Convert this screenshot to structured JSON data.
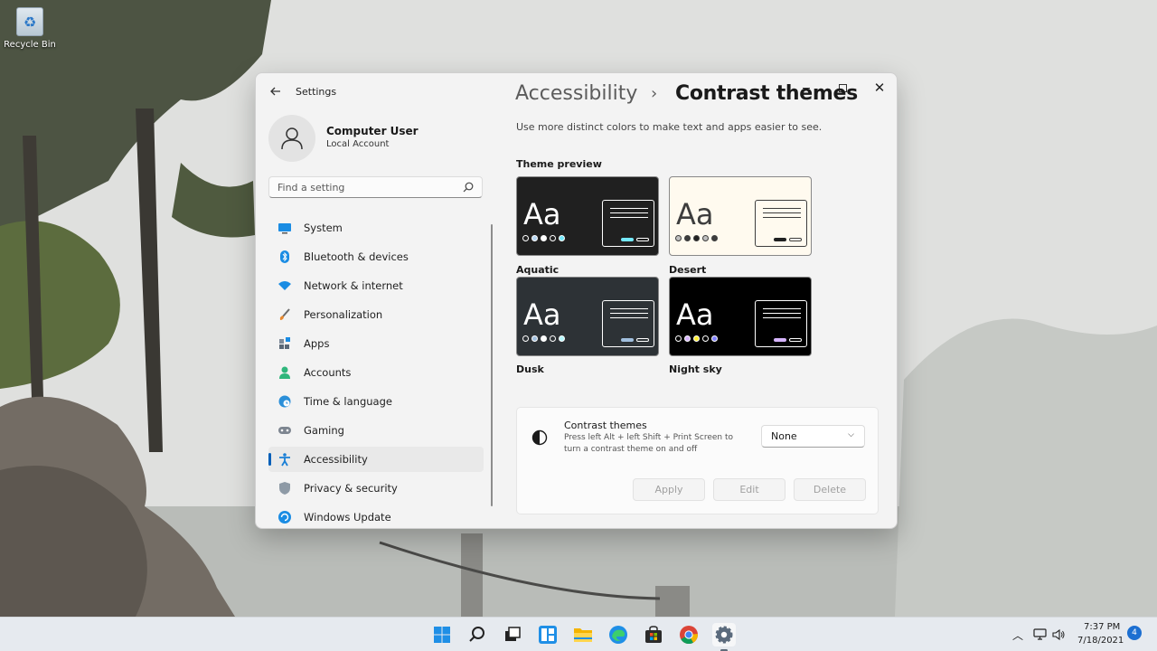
{
  "desktop": {
    "recycle_bin_label": "Recycle Bin"
  },
  "window": {
    "app_title": "Settings",
    "user": {
      "name": "Computer User",
      "account_type": "Local Account"
    },
    "search_placeholder": "Find a setting",
    "nav": [
      {
        "label": "System",
        "icon": "monitor-icon",
        "active": false
      },
      {
        "label": "Bluetooth & devices",
        "icon": "bluetooth-icon",
        "active": false
      },
      {
        "label": "Network & internet",
        "icon": "wifi-icon",
        "active": false
      },
      {
        "label": "Personalization",
        "icon": "brush-icon",
        "active": false
      },
      {
        "label": "Apps",
        "icon": "apps-icon",
        "active": false
      },
      {
        "label": "Accounts",
        "icon": "person-icon",
        "active": false
      },
      {
        "label": "Time & language",
        "icon": "globe-clock-icon",
        "active": false
      },
      {
        "label": "Gaming",
        "icon": "gamepad-icon",
        "active": false
      },
      {
        "label": "Accessibility",
        "icon": "accessibility-icon",
        "active": true
      },
      {
        "label": "Privacy & security",
        "icon": "shield-icon",
        "active": false
      },
      {
        "label": "Windows Update",
        "icon": "update-icon",
        "active": false
      }
    ],
    "breadcrumb": {
      "parent": "Accessibility",
      "separator": "›",
      "current": "Contrast themes"
    },
    "description": "Use more distinct colors to make text and apps easier to see.",
    "theme_preview_title": "Theme preview",
    "themes": [
      {
        "name": "Aquatic",
        "sample": "Aa",
        "bg": "#202020",
        "fg": "#ffffff",
        "accent": "#75e9fc",
        "dots": [
          "#202020",
          "#b6d6f2",
          "#ffffff",
          "#202020",
          "#75e9fc"
        ]
      },
      {
        "name": "Desert",
        "sample": "Aa",
        "bg": "#fffaef",
        "fg": "#3d3d3d",
        "accent": "#202020",
        "dots": [
          "#bfbfbf",
          "#3d3d3d",
          "#202020",
          "#bfbfbf",
          "#3d3d3d"
        ]
      },
      {
        "name": "Dusk",
        "sample": "Aa",
        "bg": "#2d3236",
        "fg": "#ffffff",
        "accent": "#a1bfde",
        "dots": [
          "#2d3236",
          "#a1bfde",
          "#ffffff",
          "#2d3236",
          "#b5f7fd"
        ]
      },
      {
        "name": "Night sky",
        "sample": "Aa",
        "bg": "#000000",
        "fg": "#ffffff",
        "accent": "#d6b4fd",
        "dots": [
          "#000000",
          "#d6b4fd",
          "#ffee32",
          "#000000",
          "#8080ff"
        ]
      }
    ],
    "contrast_setting": {
      "title": "Contrast themes",
      "description_line1": "Press left Alt + left Shift + Print Screen to",
      "description_line2": "turn a contrast theme on and off",
      "selected": "None",
      "buttons": {
        "apply": "Apply",
        "edit": "Edit",
        "delete": "Delete"
      }
    }
  },
  "taskbar": {
    "apps": [
      "start-icon",
      "search-icon",
      "task-view-icon",
      "widgets-icon",
      "file-explorer-icon",
      "edge-icon",
      "store-icon",
      "chrome-icon",
      "settings-icon"
    ],
    "clock": {
      "time": "7:37 PM",
      "date": "7/18/2021"
    },
    "notification_count": "4"
  }
}
